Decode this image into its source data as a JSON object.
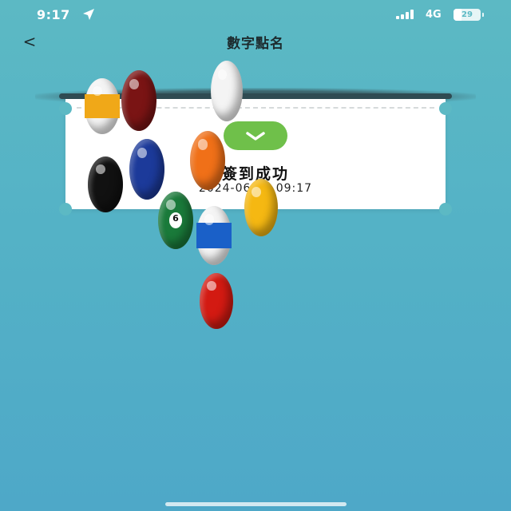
{
  "status_bar": {
    "time": "9:17",
    "network": "4G",
    "battery": "29",
    "battery_fraction": 0.29
  },
  "nav": {
    "back": "<",
    "title": "數字點名"
  },
  "ticket": {
    "status": "簽到成功",
    "timestamp": "2024-06-06 09:17",
    "check_color": "#6fc04a"
  },
  "balls": [
    {
      "name": "ball-9-yellow-stripe",
      "color": "#f0a818",
      "stripe": true
    },
    {
      "name": "ball-7-maroon",
      "color": "#7a1414",
      "stripe": false
    },
    {
      "name": "ball-cue-white",
      "color": "#f4f4f4",
      "stripe": false
    },
    {
      "name": "ball-8-black",
      "color": "#111111",
      "stripe": false
    },
    {
      "name": "ball-2-blue",
      "color": "#1c3a9a",
      "stripe": false
    },
    {
      "name": "ball-5-orange",
      "color": "#f07018",
      "stripe": false
    },
    {
      "name": "ball-1-yellow",
      "color": "#f5b812",
      "stripe": false
    },
    {
      "name": "ball-6-green",
      "color": "#1a7a3a",
      "stripe": false,
      "number": "6"
    },
    {
      "name": "ball-10-blue-stripe",
      "color": "#1a60c8",
      "stripe": true
    },
    {
      "name": "ball-3-red",
      "color": "#d31a12",
      "stripe": false
    }
  ]
}
